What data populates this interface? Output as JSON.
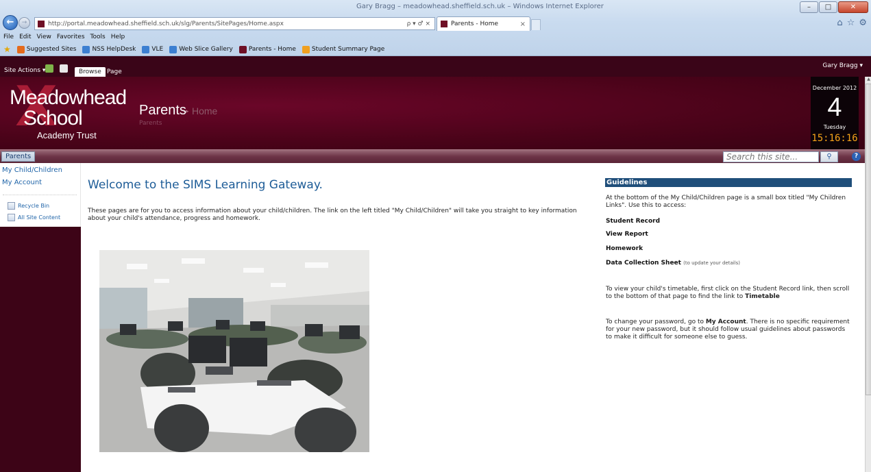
{
  "browser": {
    "window_title": "Gary Bragg – meadowhead.sheffield.sch.uk – Windows Internet Explorer",
    "address_url": "http://portal.meadowhead.sheffield.sch.uk/slg/Parents/SitePages/Home.aspx",
    "address_controls": "ρ ▾ ♂ ×",
    "tab_label": "Parents - Home",
    "tab_close": "×",
    "menu": [
      "File",
      "Edit",
      "View",
      "Favorites",
      "Tools",
      "Help"
    ],
    "favorites": [
      {
        "label": "Suggested Sites",
        "color": "#e46a1c"
      },
      {
        "label": "NSS HelpDesk",
        "color": "#3c7fd1"
      },
      {
        "label": "VLE",
        "color": "#3c7fd1"
      },
      {
        "label": "Web Slice Gallery",
        "color": "#3c7fd1"
      },
      {
        "label": "Parents - Home",
        "color": "#6e0f25"
      },
      {
        "label": "Student Summary Page",
        "color": "#f0a020"
      }
    ]
  },
  "ribbon": {
    "site_actions": "Site Actions ▾",
    "tabs": [
      "Browse",
      "Page"
    ],
    "user": "Gary Bragg ▾"
  },
  "banner": {
    "logo_line1": "Meadowhead",
    "logo_line2": "School",
    "logo_line3": "Academy Trust",
    "breadcrumb_parents": "Parents",
    "breadcrumb_sep": "▸",
    "breadcrumb_home": "Home",
    "breadcrumb_sub": "Parents"
  },
  "calendar": {
    "month": "December 2012",
    "day": "4",
    "weekday": "Tuesday",
    "time": "15:16:16"
  },
  "nav": {
    "current_tab": "Parents",
    "search_placeholder": "Search this site...",
    "help": "?"
  },
  "leftnav": {
    "links": [
      "My Child/Children",
      "My Account"
    ],
    "utility": [
      "Recycle Bin",
      "All Site Content"
    ]
  },
  "main": {
    "heading": "Welcome to the SIMS Learning Gateway.",
    "intro": "These pages are for you to access information about your child/children. The link on the left titled \"My Child/Children\" will take you straight to key information about your child's attendance, progress and homework."
  },
  "guidelines": {
    "title": "Guidelines",
    "p1": "At the bottom of the My Child/Children page is a small box titled \"My Children Links\".  Use this to access:",
    "items": [
      "Student Record",
      "View Report",
      "Homework",
      "Data Collection Sheet"
    ],
    "data_collection_note": "(to update your details)",
    "p2_prefix": "To view your child's timetable, first click on the Student Record link, then scroll to the bottom of that page to find the link to ",
    "p2_bold": "Timetable",
    "p3_prefix": "To change your password, go to ",
    "p3_bold": "My Account",
    "p3_suffix": ". There is no specific requirement for your new password, but it should follow usual guidelines about passwords to make it difficult for someone else to guess."
  },
  "colors": {
    "banner": "#4a0319",
    "ribbon": "#3a0518",
    "link": "#1f64a8",
    "heading": "#1d5c97",
    "clock": "#f6a31a"
  }
}
